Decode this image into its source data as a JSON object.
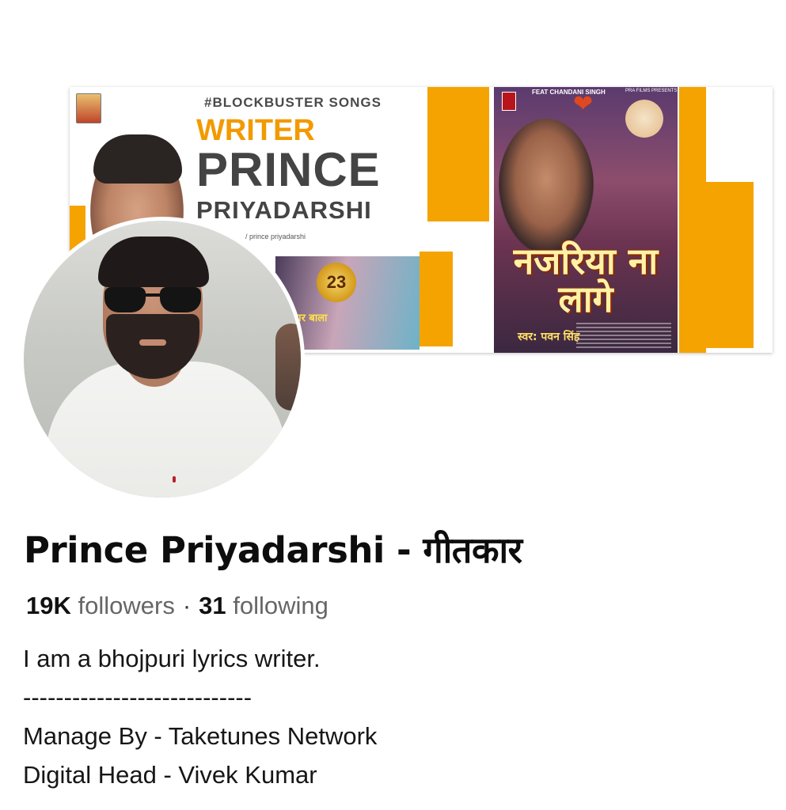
{
  "cover": {
    "hashtag": "#BLOCKBUSTER SONGS",
    "writer_label": "WRITER",
    "name_line1": "PRINCE",
    "name_line2": "PRIYADARSHI",
    "social_handle": "/ prince priyadarshi",
    "small_poster_badge": "23",
    "small_poster_title": "कुंवार बाला",
    "big_poster_feat": "FEAT CHANDANI SINGH",
    "big_poster_presents": "PRA FILMS PRESENTS",
    "big_poster_title": "नजरिया ना लागे",
    "big_poster_singer": "स्वर: पवन सिंह",
    "accent_color": "#f5a300"
  },
  "profile": {
    "name": "Prince Priyadarshi - गीतकार",
    "followers_count": "19K",
    "followers_label": "followers",
    "separator": "·",
    "following_count": "31",
    "following_label": "following",
    "bio_line1": "I am a bhojpuri lyrics writer.",
    "bio_line2": "----------------------------",
    "bio_line3": "Manage By - Taketunes Network",
    "bio_line4": "Digital Head - Vivek Kumar"
  }
}
